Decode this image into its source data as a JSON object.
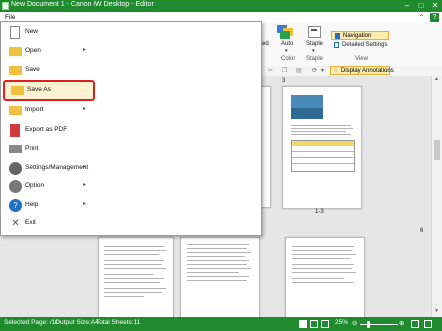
{
  "window": {
    "title": "New Document 1 - Canon iW Desktop - Editor",
    "accent_color": "#1f8a2e"
  },
  "menubar": {
    "file_label": "File"
  },
  "file_menu": {
    "items": [
      {
        "label": "New",
        "icon": "new-document-icon"
      },
      {
        "label": "Open",
        "icon": "open-folder-icon",
        "submenu": true
      },
      {
        "label": "Save",
        "icon": "save-icon"
      },
      {
        "label": "Save As",
        "icon": "save-as-icon",
        "selected": true
      },
      {
        "label": "Import",
        "icon": "import-icon",
        "submenu": true
      },
      {
        "label": "Export as PDF",
        "icon": "pdf-icon"
      },
      {
        "label": "Print",
        "icon": "print-icon"
      },
      {
        "label": "Settings/Management",
        "icon": "settings-icon",
        "submenu": true
      },
      {
        "label": "Option",
        "icon": "option-icon",
        "submenu": true
      },
      {
        "label": "Help",
        "icon": "help-icon",
        "submenu": true
      },
      {
        "label": "Exit",
        "icon": "close-icon"
      }
    ],
    "submenu_glyph": "▸"
  },
  "ribbon": {
    "auto_label": "Auto",
    "staple_label": "Staple",
    "group_color": "Color",
    "group_staple": "Staple",
    "group_view": "View",
    "navigation_label": "Navigation",
    "detailed_settings_label": "Detailed Settings",
    "display_annotations_label": "Display Annotations",
    "partial_label": "ed"
  },
  "pages": {
    "label_3": "3",
    "label_1_3": "1-3",
    "label_6": "6"
  },
  "status": {
    "selected_page": "Selected Page: /11",
    "output_size": "Output Size:A4",
    "total_sheets": "Total Sheets:11",
    "zoom": "25%"
  }
}
